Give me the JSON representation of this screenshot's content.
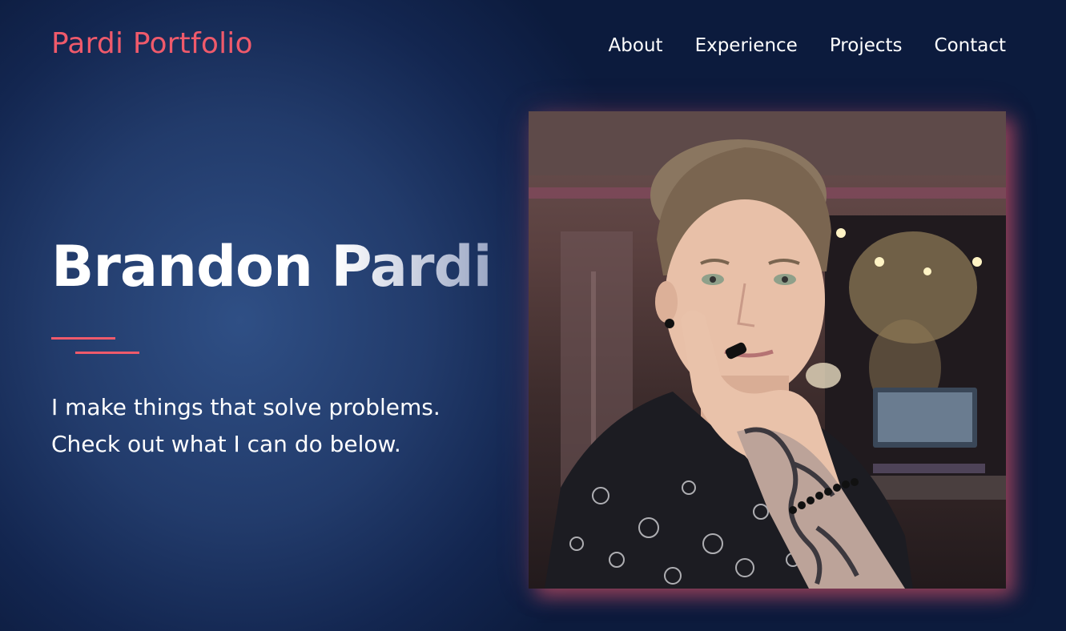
{
  "header": {
    "brand": "Pardi Portfolio",
    "nav": [
      {
        "label": "About"
      },
      {
        "label": "Experience"
      },
      {
        "label": "Projects"
      },
      {
        "label": "Contact"
      }
    ]
  },
  "hero": {
    "name": "Brandon Pardi",
    "tagline_line1": "I make things that solve problems.",
    "tagline_line2": "Check out what I can do below."
  },
  "colors": {
    "accent": "#ef5a6b",
    "background_dark": "#0c1b3d",
    "background_light": "#2f4f85",
    "text": "#ffffff"
  }
}
